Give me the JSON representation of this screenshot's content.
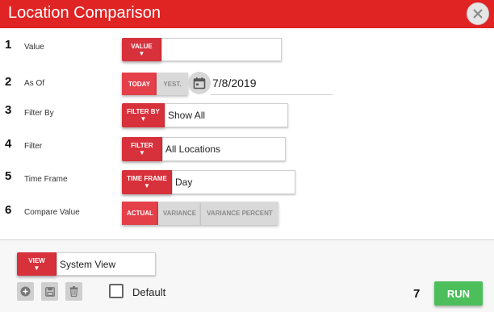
{
  "window": {
    "title": "Location Comparison",
    "close_icon": "close-icon"
  },
  "rows": [
    {
      "num": "1",
      "label": "Value",
      "button": "VALUE",
      "arrow": "▼",
      "value": ""
    },
    {
      "num": "2",
      "label": "As Of",
      "today": "TODAY",
      "yesterday": "YEST.",
      "date": "7/8/2019",
      "calendar_icon": "calendar-icon"
    },
    {
      "num": "3",
      "label": "Filter By",
      "button": "FILTER BY",
      "arrow": "▼",
      "value": "Show All"
    },
    {
      "num": "4",
      "label": "Filter",
      "button": "FILTER",
      "arrow": "▼",
      "value": "All Locations"
    },
    {
      "num": "5",
      "label": "Time Frame",
      "button": "TIME FRAME",
      "arrow": "▼",
      "value": "Day"
    },
    {
      "num": "6",
      "label": "Compare Value",
      "options": [
        "ACTUAL",
        "VARIANCE",
        "VARIANCE PERCENT"
      ],
      "selected": "ACTUAL"
    }
  ],
  "footer": {
    "view_button": "VIEW",
    "view_arrow": "▼",
    "view_value": "System View",
    "icons": [
      "add-icon",
      "save-icon",
      "delete-icon"
    ],
    "default_label": "Default",
    "default_checked": false,
    "run_num": "7",
    "run_label": "RUN"
  },
  "colors": {
    "title_bar": "#e02424",
    "primary_red": "#d7313b",
    "run_green": "#4cbf5b"
  }
}
